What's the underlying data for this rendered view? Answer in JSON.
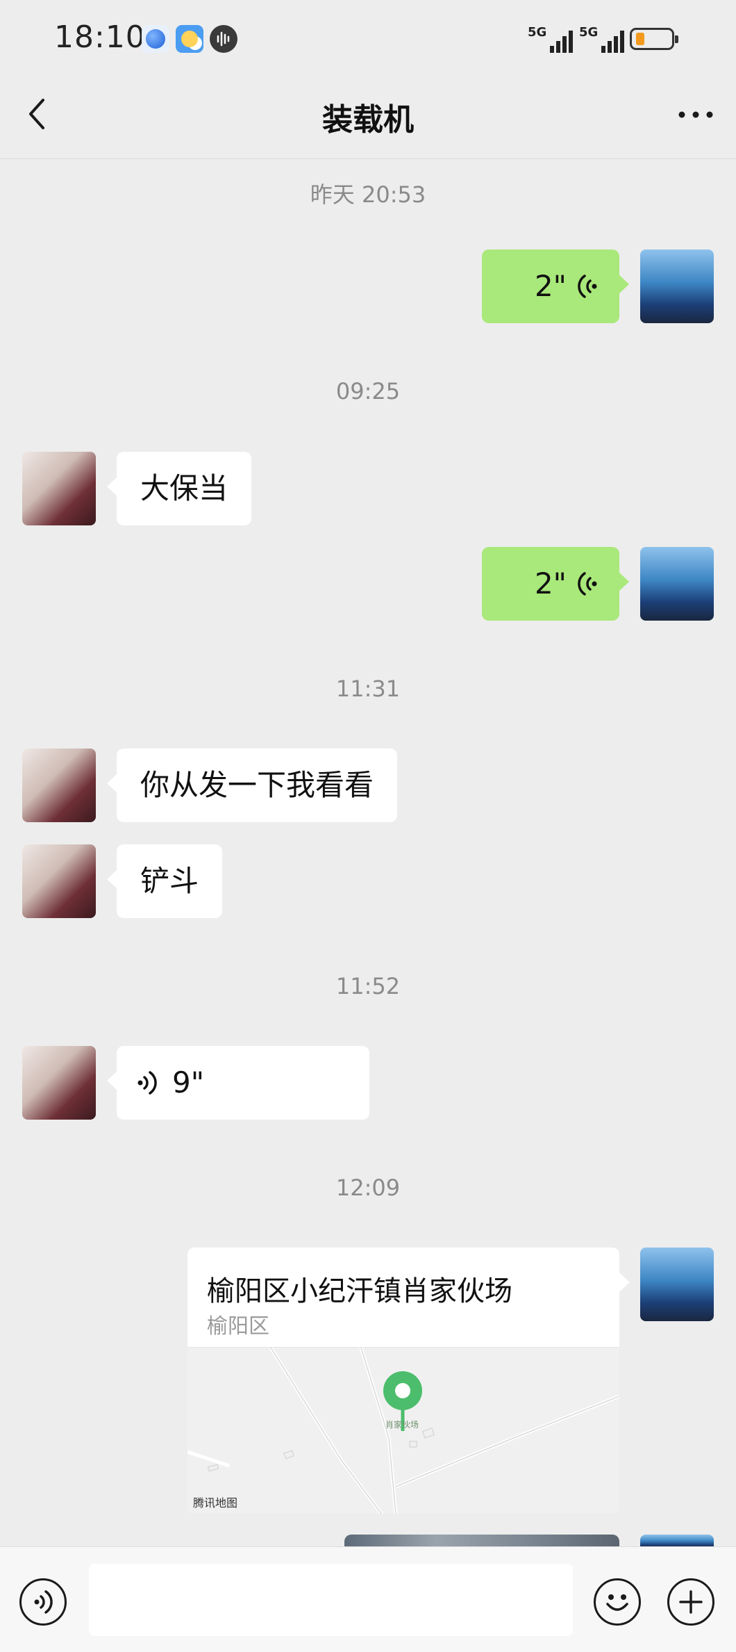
{
  "status_bar": {
    "time": "18:10",
    "network_1": "5G",
    "network_2": "5G",
    "battery_level": 0.2
  },
  "header": {
    "title": "装载机",
    "back_icon": "chevron-left-icon",
    "more_icon": "more-dots-icon"
  },
  "chat": {
    "timestamps": [
      "昨天 20:53",
      "09:25",
      "11:31",
      "11:52",
      "12:09"
    ],
    "messages": [
      {
        "sender": "self",
        "type": "voice",
        "duration": "2\""
      },
      {
        "sender": "friend",
        "type": "text",
        "text": "大保当"
      },
      {
        "sender": "self",
        "type": "voice",
        "duration": "2\""
      },
      {
        "sender": "friend",
        "type": "text",
        "text": "你从发一下我看看"
      },
      {
        "sender": "friend",
        "type": "text",
        "text": "铲斗"
      },
      {
        "sender": "friend",
        "type": "voice",
        "duration": "9\""
      },
      {
        "sender": "self",
        "type": "location",
        "title": "榆阳区小纪汗镇肖家伙场",
        "subtitle": "榆阳区",
        "map_label": "肖家伙场",
        "map_provider": "腾讯地图"
      }
    ]
  },
  "input_bar": {
    "voice_icon": "voice-mode-icon",
    "emoji_icon": "emoji-icon",
    "plus_icon": "plus-icon",
    "text_value": ""
  }
}
